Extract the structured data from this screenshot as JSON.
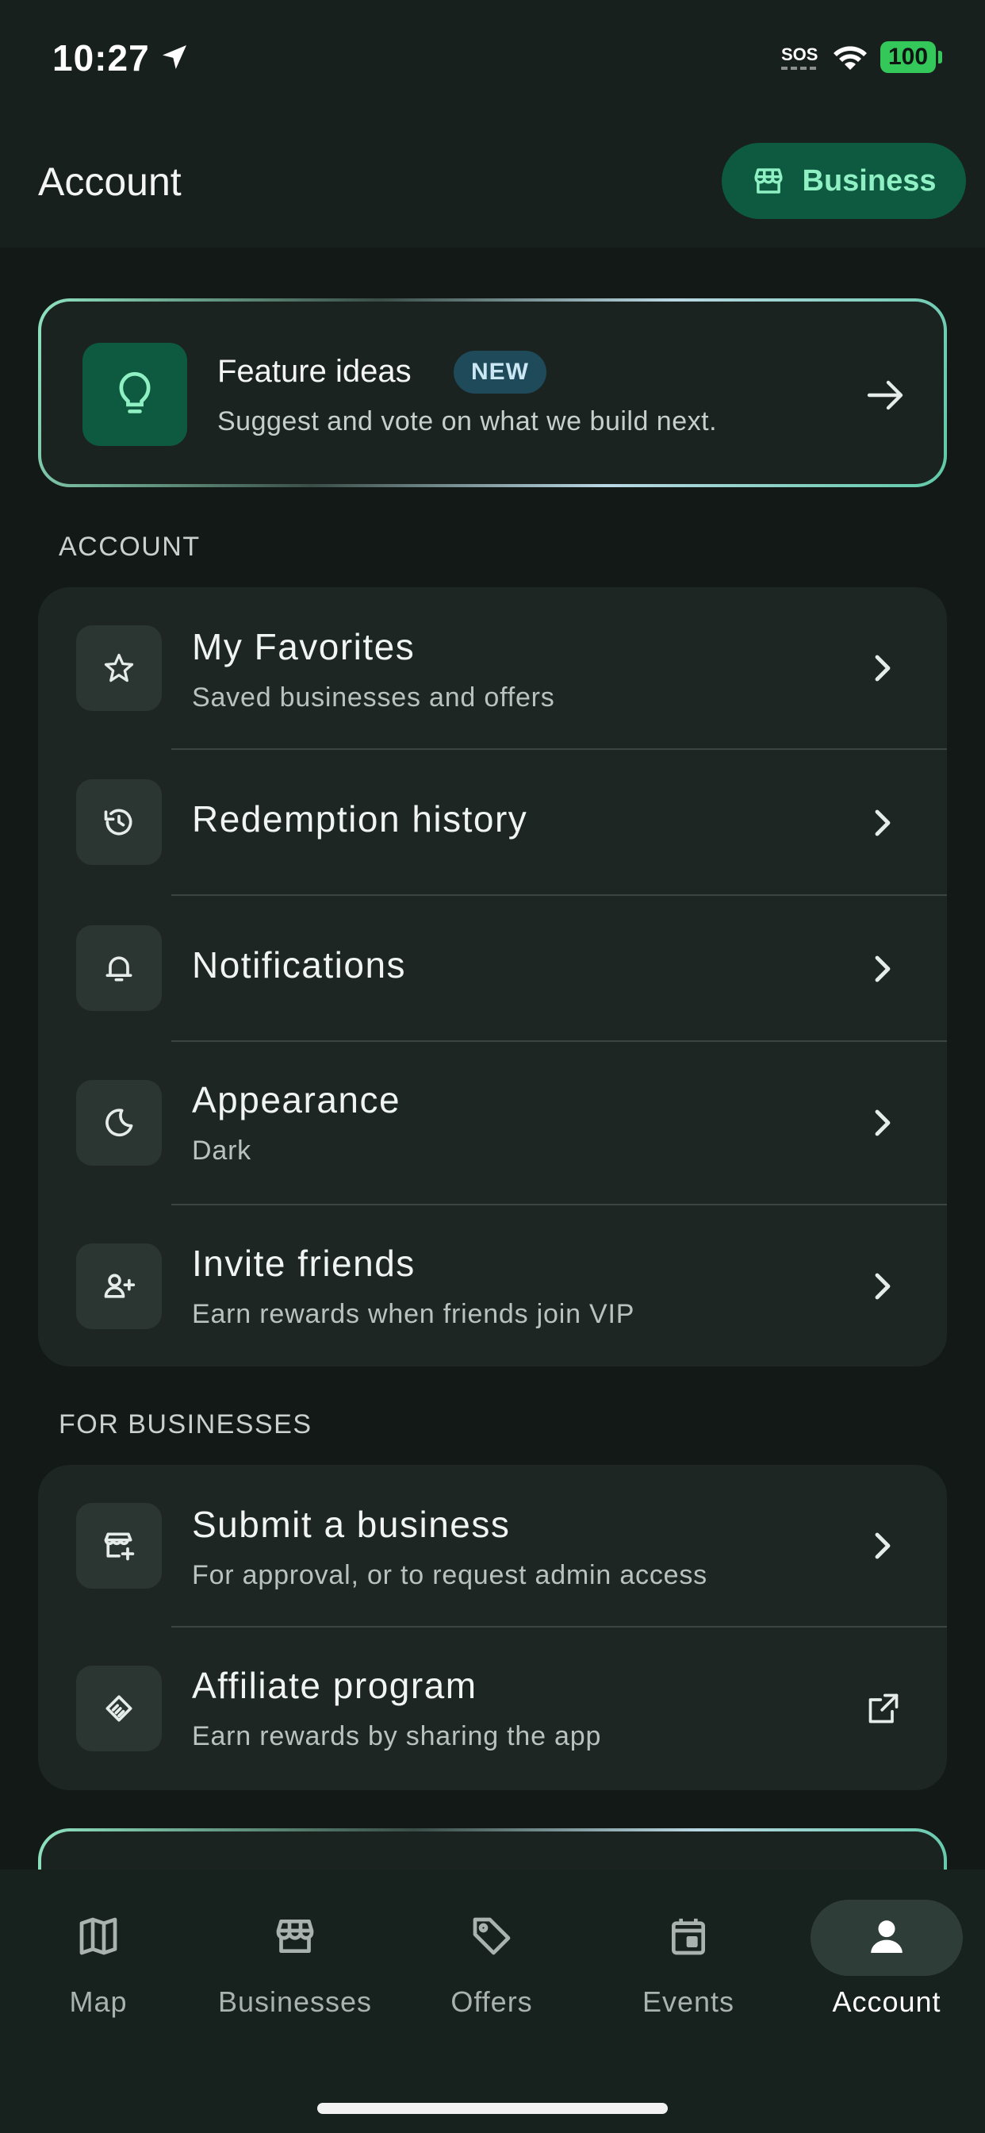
{
  "status_bar": {
    "time": "10:27",
    "sos": "SOS",
    "battery": "100"
  },
  "header": {
    "title": "Account",
    "business_button": "Business"
  },
  "feature_card": {
    "title": "Feature ideas",
    "badge": "NEW",
    "subtitle": "Suggest and vote on what we build next."
  },
  "account_section": {
    "header": "ACCOUNT",
    "items": [
      {
        "title": "My Favorites",
        "subtitle": "Saved businesses and offers",
        "icon": "star-icon"
      },
      {
        "title": "Redemption history",
        "subtitle": "",
        "icon": "history-icon"
      },
      {
        "title": "Notifications",
        "subtitle": "",
        "icon": "bell-icon"
      },
      {
        "title": "Appearance",
        "subtitle": "Dark",
        "icon": "moon-icon"
      },
      {
        "title": "Invite friends",
        "subtitle": "Earn rewards when friends join VIP",
        "icon": "user-plus-icon"
      }
    ]
  },
  "business_section": {
    "header": "FOR BUSINESSES",
    "items": [
      {
        "title": "Submit a business",
        "subtitle": "For approval, or to request admin access",
        "icon": "store-add-icon"
      },
      {
        "title": "Affiliate program",
        "subtitle": "Earn rewards by sharing the app",
        "icon": "handshake-icon"
      }
    ]
  },
  "tab_bar": {
    "tabs": [
      {
        "label": "Map",
        "icon": "map-icon"
      },
      {
        "label": "Businesses",
        "icon": "store-icon"
      },
      {
        "label": "Offers",
        "icon": "tag-icon"
      },
      {
        "label": "Events",
        "icon": "calendar-icon"
      },
      {
        "label": "Account",
        "icon": "person-icon"
      }
    ],
    "active": "Account"
  },
  "colors": {
    "background": "#121917",
    "accent": "#8ff0c3",
    "accent_bg": "#0d5a40"
  }
}
